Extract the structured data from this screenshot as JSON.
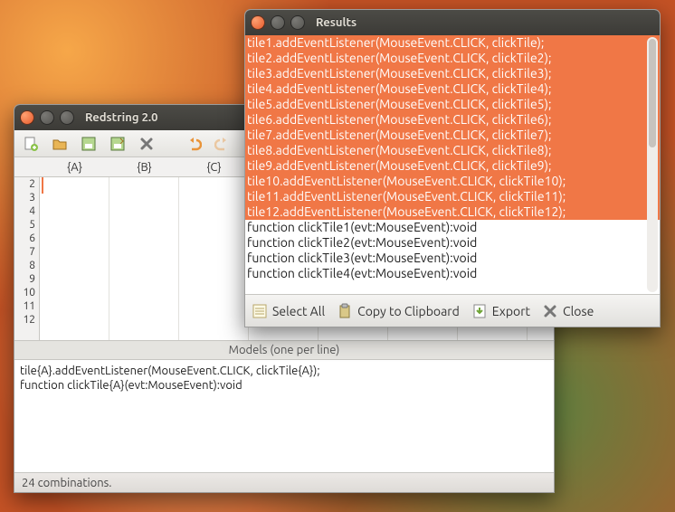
{
  "main_window": {
    "title": "Redstring 2.0",
    "column_headers": [
      "{A}",
      "{B}",
      "{C}"
    ],
    "row_numbers": [
      "2",
      "3",
      "4",
      "5",
      "6",
      "7",
      "8",
      "9",
      "10",
      "11",
      "12"
    ],
    "section_label": "Models (one per line)",
    "models_text": "tile{A}.addEventListener(MouseEvent.CLICK, clickTile{A});\nfunction clickTile{A}(evt:MouseEvent):void",
    "status": "24 combinations."
  },
  "results_window": {
    "title": "Results",
    "selected_lines": [
      "tile1.addEventListener(MouseEvent.CLICK, clickTile);",
      "tile2.addEventListener(MouseEvent.CLICK, clickTile2);",
      "tile3.addEventListener(MouseEvent.CLICK, clickTile3);",
      "tile4.addEventListener(MouseEvent.CLICK, clickTile4);",
      "tile5.addEventListener(MouseEvent.CLICK, clickTile5);",
      "tile6.addEventListener(MouseEvent.CLICK, clickTile6);",
      "tile7.addEventListener(MouseEvent.CLICK, clickTile7);",
      "tile8.addEventListener(MouseEvent.CLICK, clickTile8);",
      "tile9.addEventListener(MouseEvent.CLICK, clickTile9);",
      "tile10.addEventListener(MouseEvent.CLICK, clickTile10);",
      "tile11.addEventListener(MouseEvent.CLICK, clickTile11);",
      "tile12.addEventListener(MouseEvent.CLICK, clickTile12);"
    ],
    "unselected_lines": [
      "function clickTile1(evt:MouseEvent):void",
      "function clickTile2(evt:MouseEvent):void",
      "function clickTile3(evt:MouseEvent):void",
      "function clickTile4(evt:MouseEvent):void"
    ],
    "toolbar": {
      "select_all": "Select All",
      "copy": "Copy to Clipboard",
      "export": "Export",
      "close": "Close"
    }
  }
}
